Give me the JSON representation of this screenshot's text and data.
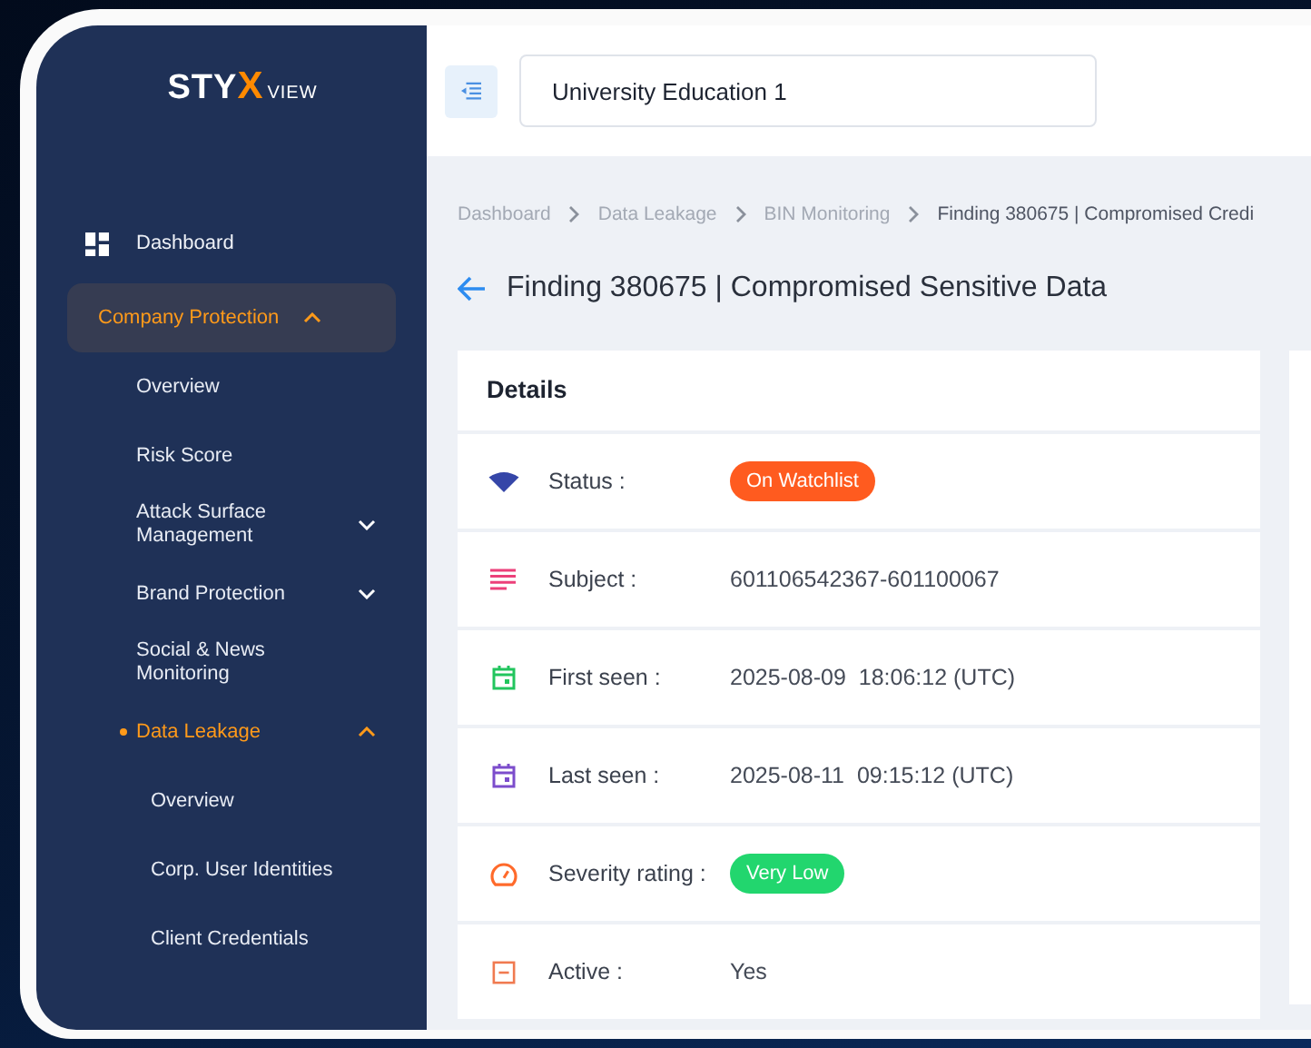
{
  "sidebar": {
    "logo": {
      "main": "STY",
      "accent": "X",
      "suffix": "VIEW"
    },
    "items": [
      {
        "label": "Dashboard",
        "selected": false
      },
      {
        "label": "Company Protection",
        "selected": true,
        "expanded": true,
        "children": [
          {
            "label": "Overview",
            "selected": false
          },
          {
            "label": "Risk Score",
            "selected": false
          },
          {
            "label": "Attack Surface Management",
            "selected": false,
            "expanded": false
          },
          {
            "label": "Brand Protection",
            "selected": false,
            "expanded": false
          },
          {
            "label": "Social & News Monitoring",
            "selected": false
          },
          {
            "label": "Data Leakage",
            "selected": true,
            "expanded": true,
            "children": [
              {
                "label": "Overview",
                "selected": false
              },
              {
                "label": "Corp. User Identities",
                "selected": false
              },
              {
                "label": "Client Credentials",
                "selected": false
              }
            ]
          }
        ]
      }
    ]
  },
  "header": {
    "organization": "University Education 1"
  },
  "breadcrumb": [
    "Dashboard",
    "Data Leakage",
    "BIN Monitoring",
    "Finding 380675 | Compromised Credi"
  ],
  "page_title": "Finding 380675 | Compromised Sensitive Data",
  "details": {
    "title": "Details",
    "rows": [
      {
        "label": "Status :",
        "kind": "badge",
        "value": "On Watchlist",
        "color": "#ff5b1f"
      },
      {
        "label": "Subject :",
        "kind": "text",
        "value": "601106542367-601100067"
      },
      {
        "label": "First seen :",
        "kind": "text",
        "value": "2025-08-09  18:06:12 (UTC)"
      },
      {
        "label": "Last seen :",
        "kind": "text",
        "value": "2025-08-11  09:15:12 (UTC)"
      },
      {
        "label": "Severity rating :",
        "kind": "badge",
        "value": "Very Low",
        "color": "#22d66e"
      },
      {
        "label": "Active :",
        "kind": "text",
        "value": "Yes"
      }
    ]
  }
}
